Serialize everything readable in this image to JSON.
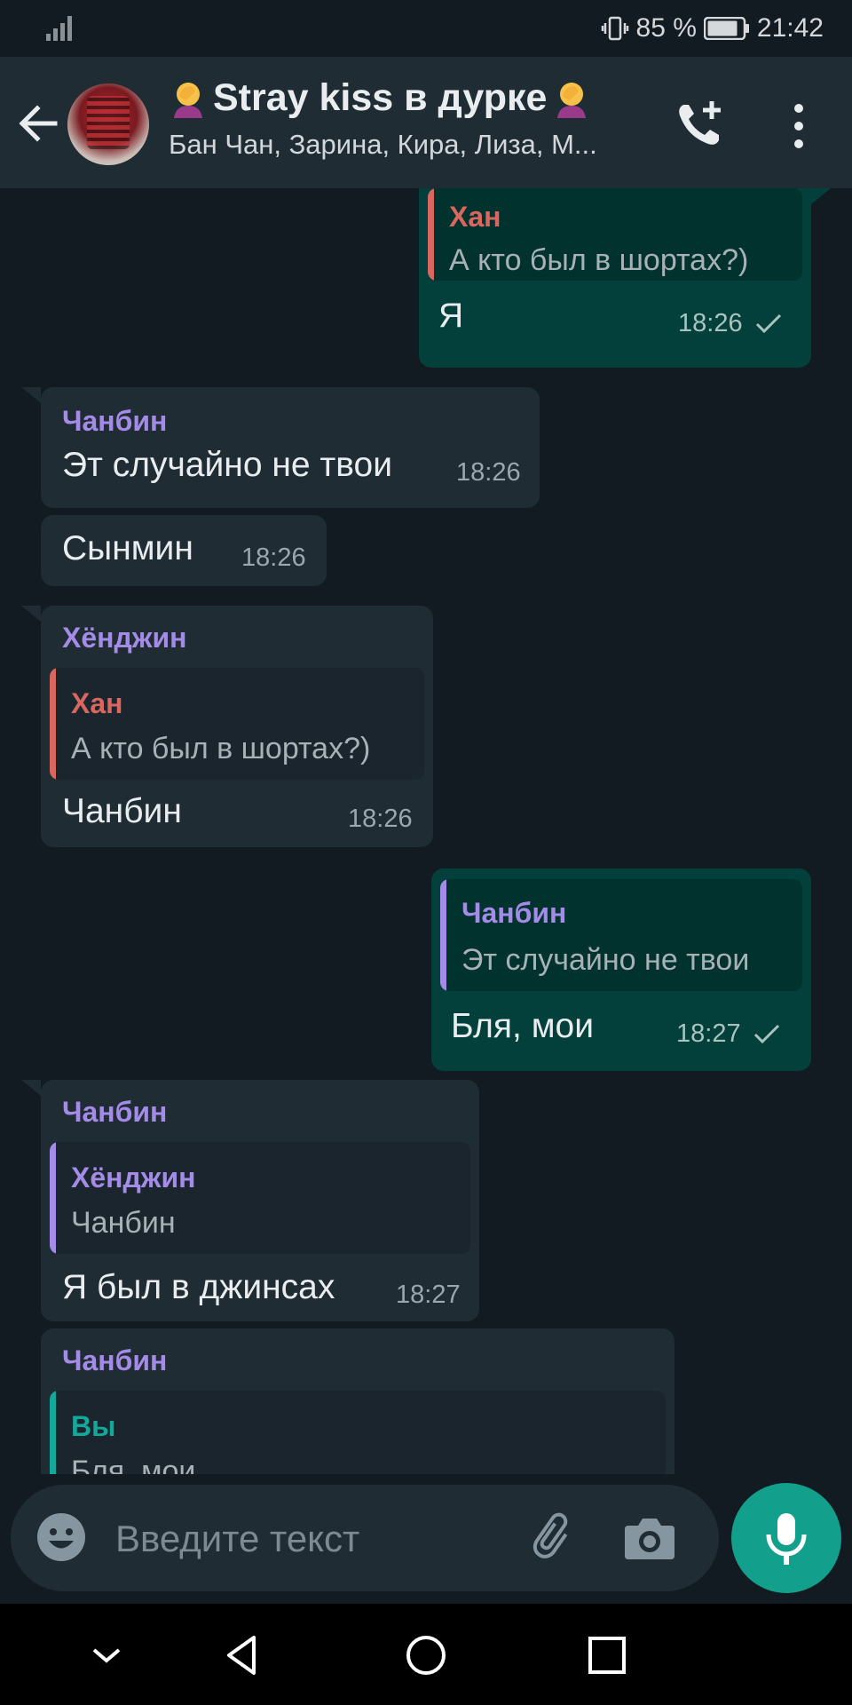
{
  "status_bar": {
    "battery_percent": "85 %",
    "time": "21:42"
  },
  "header": {
    "title": "Stray kiss в дурке",
    "subtitle": "Бан Чан, Зарина, Кира, Лиза, М...",
    "icons": [
      "back-arrow-icon",
      "group-avatar",
      "add-call-icon",
      "more-vert-icon"
    ]
  },
  "messages": [
    {
      "direction": "out",
      "quote": {
        "name": "Хан",
        "text": "А кто был в шортах?)"
      },
      "text": "Я",
      "time": "18:26",
      "status": "sent"
    },
    {
      "direction": "in",
      "sender": "Чанбин",
      "text": "Эт случайно не твои",
      "time": "18:26"
    },
    {
      "direction": "in",
      "text": "Сынмин",
      "time": "18:26"
    },
    {
      "direction": "in",
      "sender": "Хёнджин",
      "quote": {
        "name": "Хан",
        "text": "А кто был в шортах?)"
      },
      "text": "Чанбин",
      "time": "18:26"
    },
    {
      "direction": "out",
      "quote": {
        "name": "Чанбин",
        "text": "Эт случайно не твои"
      },
      "text": "Бля, мои",
      "time": "18:27",
      "status": "sent"
    },
    {
      "direction": "in",
      "sender": "Чанбин",
      "quote": {
        "name": "Хёнджин",
        "text": "Чанбин"
      },
      "text": "Я был в джинсах",
      "time": "18:27"
    },
    {
      "direction": "in",
      "sender": "Чанбин",
      "quote": {
        "name": "Вы",
        "text": "Бля, мои"
      }
    }
  ],
  "input": {
    "placeholder": "Введите текст"
  },
  "colors": {
    "background": "#111b21",
    "bubble_in": "#1f2c34",
    "bubble_out": "#03403b",
    "sender_purple": "#a58be8",
    "quote_red": "#d9675f",
    "quote_teal": "#14a89a",
    "mic_button": "#12a08c"
  }
}
